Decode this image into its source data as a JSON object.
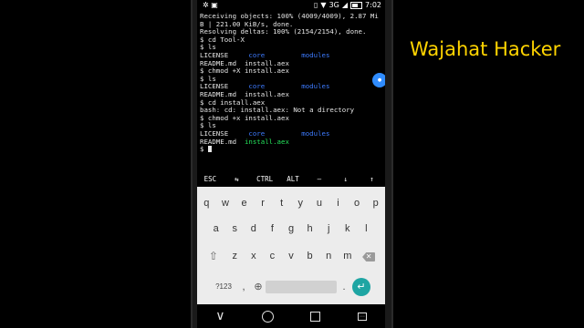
{
  "status_bar": {
    "time": "7:02",
    "network": "3G",
    "left_icons": [
      "settings-icon",
      "notification-icon"
    ],
    "right_icons": [
      "vibrate-icon",
      "wifi-icon",
      "signal-icon",
      "battery-icon"
    ]
  },
  "terminal": {
    "lines": [
      [
        {
          "t": "Receiving objects: 100% (4009/4009), 2.87 Mi",
          "c": ""
        }
      ],
      [
        {
          "t": "B | 221.00 KiB/s, done.",
          "c": ""
        }
      ],
      [
        {
          "t": "Resolving deltas: 100% (2154/2154), done.",
          "c": ""
        }
      ],
      [
        {
          "t": "$ cd Tool-X",
          "c": ""
        }
      ],
      [
        {
          "t": "$ ls",
          "c": ""
        }
      ],
      [
        {
          "t": "LICENSE     ",
          "c": ""
        },
        {
          "t": "core",
          "c": "blue"
        },
        {
          "t": "         ",
          "c": ""
        },
        {
          "t": "modules",
          "c": "blue"
        }
      ],
      [
        {
          "t": "README.md  install.aex",
          "c": ""
        }
      ],
      [
        {
          "t": "$ chmod +X install.aex",
          "c": ""
        }
      ],
      [
        {
          "t": "$ ls",
          "c": ""
        }
      ],
      [
        {
          "t": "LICENSE     ",
          "c": ""
        },
        {
          "t": "core",
          "c": "blue"
        },
        {
          "t": "         ",
          "c": ""
        },
        {
          "t": "modules",
          "c": "blue"
        }
      ],
      [
        {
          "t": "README.md  install.aex",
          "c": ""
        }
      ],
      [
        {
          "t": "$ cd install.aex",
          "c": ""
        }
      ],
      [
        {
          "t": "bash: cd: install.aex: Not a directory",
          "c": ""
        }
      ],
      [
        {
          "t": "$ chmod +x install.aex",
          "c": ""
        }
      ],
      [
        {
          "t": "$ ls",
          "c": ""
        }
      ],
      [
        {
          "t": "LICENSE     ",
          "c": ""
        },
        {
          "t": "core",
          "c": "blue"
        },
        {
          "t": "         ",
          "c": ""
        },
        {
          "t": "modules",
          "c": "blue"
        }
      ],
      [
        {
          "t": "README.md  ",
          "c": ""
        },
        {
          "t": "install.aex",
          "c": "green"
        }
      ],
      [
        {
          "t": "$ ",
          "c": ""
        }
      ]
    ],
    "colors": {
      "blue": "#3d7bff",
      "green": "#25e25b",
      "text": "#e6e6e6"
    }
  },
  "extra_keys": [
    "ESC",
    "⇆",
    "CTRL",
    "ALT",
    "—",
    "↓",
    "↑"
  ],
  "keyboard": {
    "row1": [
      "q",
      "w",
      "e",
      "r",
      "t",
      "y",
      "u",
      "i",
      "o",
      "p"
    ],
    "row2": [
      "a",
      "s",
      "d",
      "f",
      "g",
      "h",
      "j",
      "k",
      "l"
    ],
    "row3": [
      "z",
      "x",
      "c",
      "v",
      "b",
      "n",
      "m"
    ],
    "symbols_label": "?123",
    "comma": ",",
    "period": ".",
    "accent_color": "#1ea5a3"
  },
  "watermark": {
    "text": "Wajahat Hacker",
    "color": "#ffd400"
  }
}
